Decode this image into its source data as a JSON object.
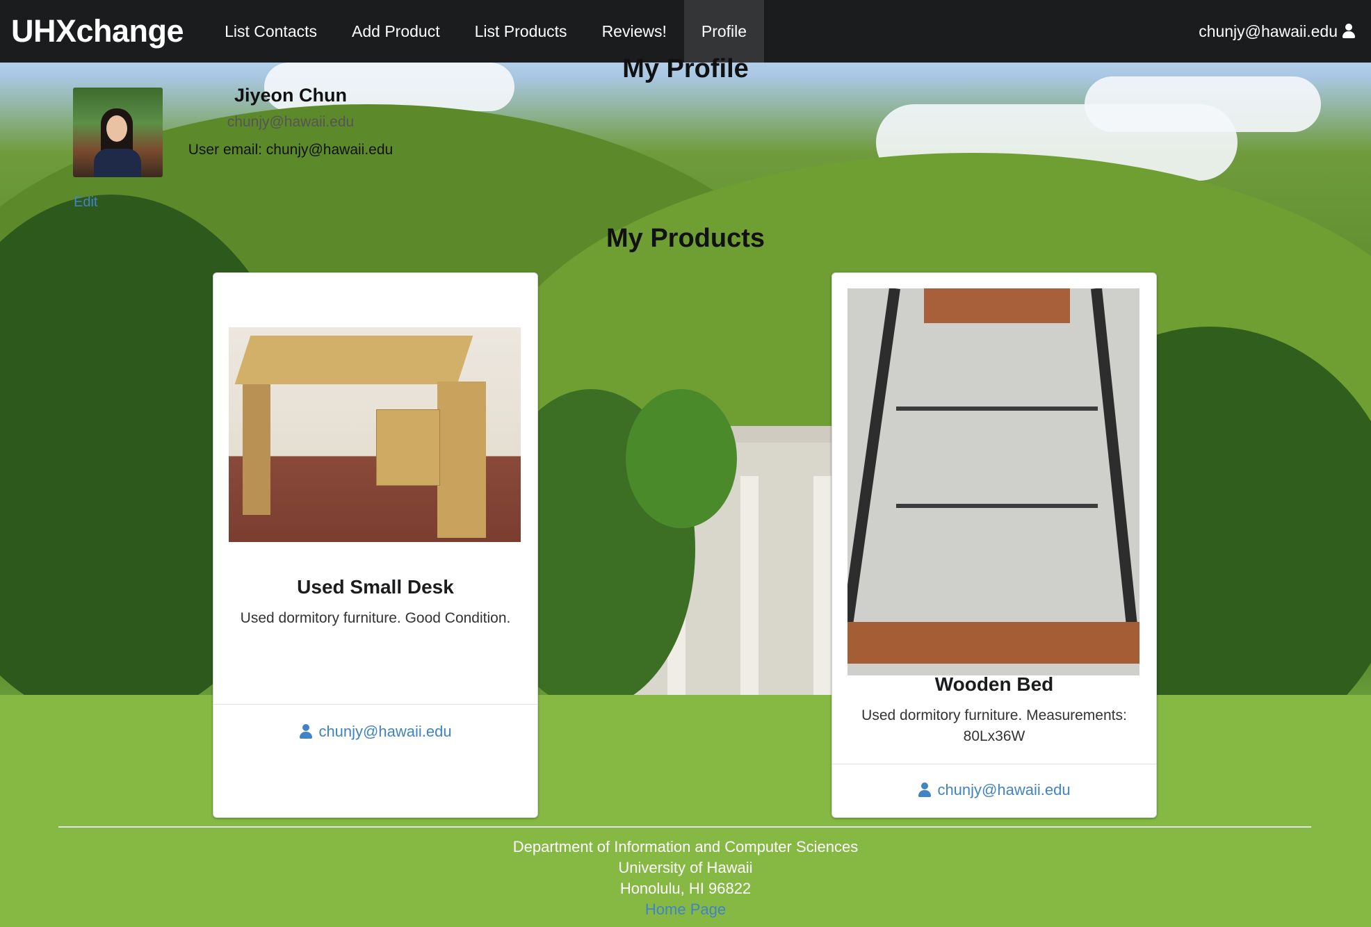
{
  "navbar": {
    "brand": "UHXchange",
    "items": [
      {
        "label": "List Contacts"
      },
      {
        "label": "Add Product"
      },
      {
        "label": "List Products"
      },
      {
        "label": "Reviews!"
      },
      {
        "label": "Profile",
        "active": true
      }
    ],
    "user_email": "chunjy@hawaii.edu"
  },
  "profile": {
    "title": "My Profile",
    "name": "Jiyeon Chun",
    "email": "chunjy@hawaii.edu",
    "user_email_line": "User email: chunjy@hawaii.edu",
    "edit_label": "Edit"
  },
  "products": {
    "title": "My Products",
    "items": [
      {
        "name": "Used Small Desk",
        "description": "Used dormitory furniture. Good Condition.",
        "owner": "chunjy@hawaii.edu"
      },
      {
        "name": "Wooden Bed",
        "description": "Used dormitory furniture. Measurements: 80Lx36W",
        "owner": "chunjy@hawaii.edu"
      }
    ]
  },
  "footer": {
    "line1": "Department of Information and Computer Sciences",
    "line2": "University of Hawaii",
    "line3": "Honolulu, HI 96822",
    "home_link": "Home Page"
  },
  "colors": {
    "navbar_bg": "#1b1c1d",
    "active_tab_bg": "#343536",
    "link": "#4183c4"
  },
  "icons": [
    "user-icon"
  ]
}
